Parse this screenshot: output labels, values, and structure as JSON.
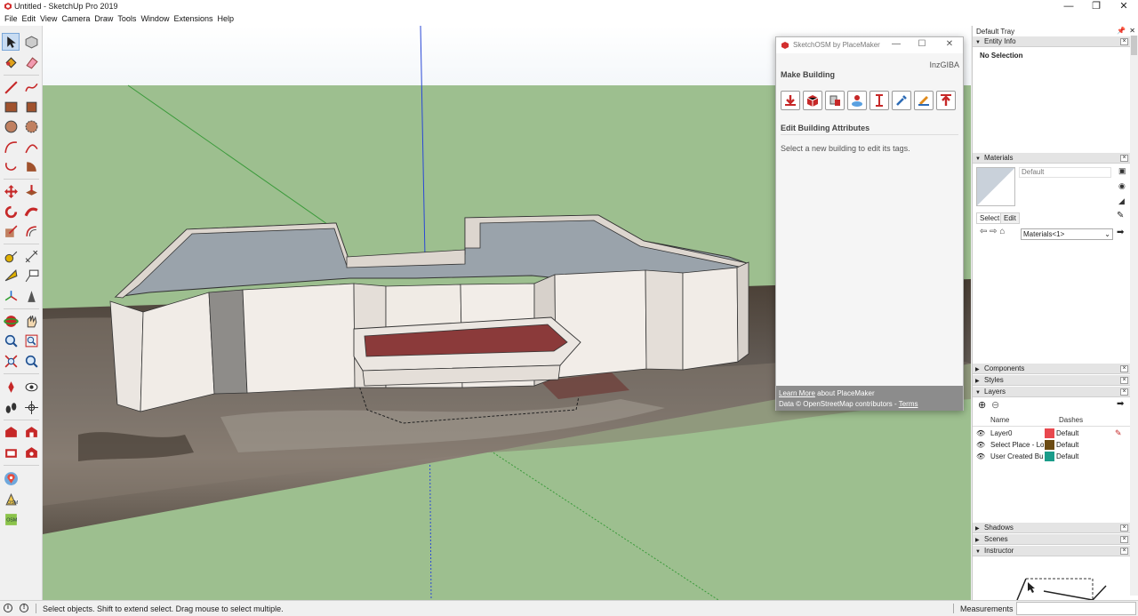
{
  "window": {
    "title": "Untitled - SketchUp Pro 2019",
    "controls": [
      "—",
      "❐",
      "✕"
    ]
  },
  "menu": [
    "File",
    "Edit",
    "View",
    "Camera",
    "Draw",
    "Tools",
    "Window",
    "Extensions",
    "Help"
  ],
  "plugin": {
    "title": "SketchOSM by PlaceMaker",
    "user": "InzGIBA",
    "make_building": "Make Building",
    "edit_attrs": "Edit Building Attributes",
    "select_hint": "Select a new building to edit its tags.",
    "footer_link": "Learn More",
    "footer_line1_rest": " about PlaceMaker",
    "footer_line2": "Data © OpenStreetMap contributors - ",
    "footer_terms": "Terms"
  },
  "tray": {
    "title": "Default Tray",
    "entity_info": "Entity Info",
    "no_selection": "No Selection",
    "materials": "Materials",
    "material_name": "Default",
    "tab_select": "Select",
    "tab_edit": "Edit",
    "material_collection": "Materials<1>",
    "components": "Components",
    "styles": "Styles",
    "layers": "Layers",
    "layers_col_name": "Name",
    "layers_col_dashes": "Dashes",
    "layers_list": [
      {
        "name": "Layer0",
        "color": "#e8484e",
        "dashes": "Default"
      },
      {
        "name": "Select Place - Loca",
        "color": "#6b4a12",
        "dashes": "Default"
      },
      {
        "name": "User Created Build",
        "color": "#1a9c8a",
        "dashes": "Default"
      }
    ],
    "shadows": "Shadows",
    "scenes": "Scenes",
    "instructor": "Instructor"
  },
  "status": {
    "text": "Select objects. Shift to extend select. Drag mouse to select multiple.",
    "measurements_label": "Measurements"
  },
  "colors": {
    "sky": "#ffffff",
    "ground": "#9dbf8f",
    "wall": "#e8e2dc",
    "roof": "#9aa3ab",
    "balcony": "#8b3a3a",
    "accent_red": "#c0392b"
  }
}
